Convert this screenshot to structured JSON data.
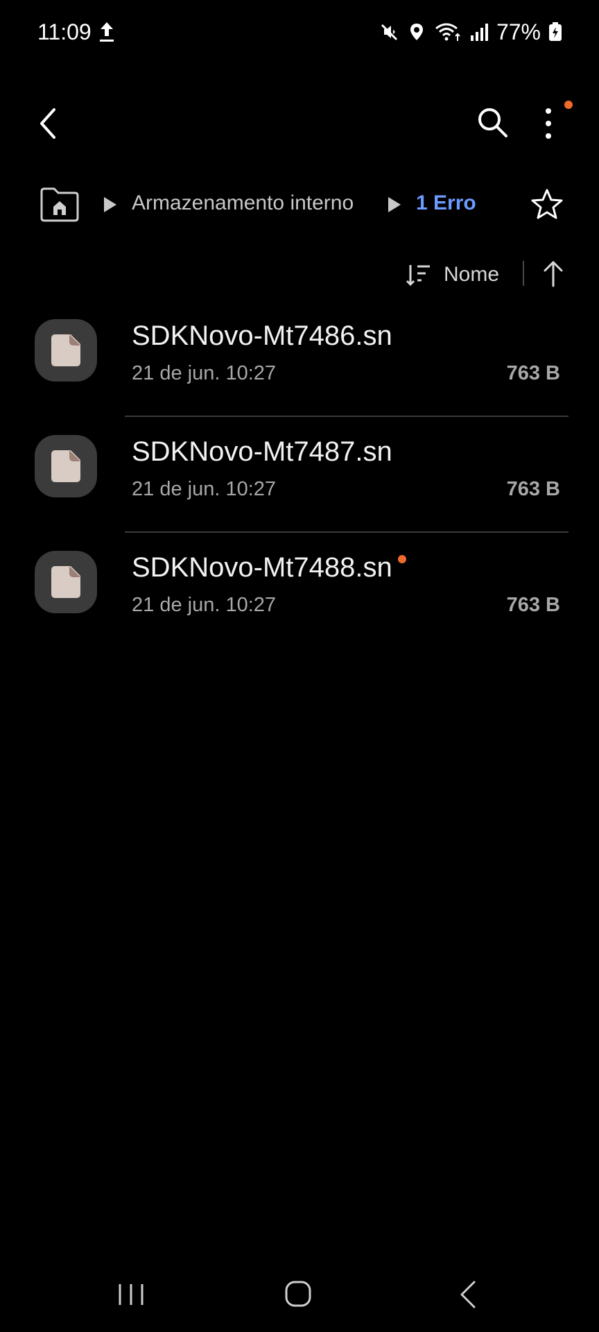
{
  "status_bar": {
    "time": "11:09",
    "battery_percent": "77%",
    "icons": [
      "upload-icon",
      "mute-icon",
      "location-icon",
      "wifi-icon",
      "signal-icon",
      "battery-icon"
    ]
  },
  "toolbar": {
    "back_icon": "chevron-left-icon",
    "search_icon": "search-icon",
    "more_icon": "more-vertical-icon",
    "notification_dot_color": "#f06b2b"
  },
  "breadcrumb": {
    "home_icon": "home-folder-icon",
    "items": [
      "Armazenamento interno",
      "1 Erro"
    ],
    "current_color": "#6c9cff",
    "favorite_icon": "star-icon"
  },
  "sort": {
    "label": "Nome",
    "sort_icon": "sort-icon",
    "direction_icon": "arrow-up-icon"
  },
  "files": [
    {
      "name": "SDKNovo-Mt7486.sn",
      "date": "21 de jun. 10:27",
      "size": "763 B",
      "is_new": false
    },
    {
      "name": "SDKNovo-Mt7487.sn",
      "date": "21 de jun. 10:27",
      "size": "763 B",
      "is_new": false
    },
    {
      "name": "SDKNovo-Mt7488.sn",
      "date": "21 de jun. 10:27",
      "size": "763 B",
      "is_new": true
    }
  ],
  "nav_bar": {
    "icons": [
      "recents-icon",
      "home-icon",
      "back-icon"
    ]
  }
}
